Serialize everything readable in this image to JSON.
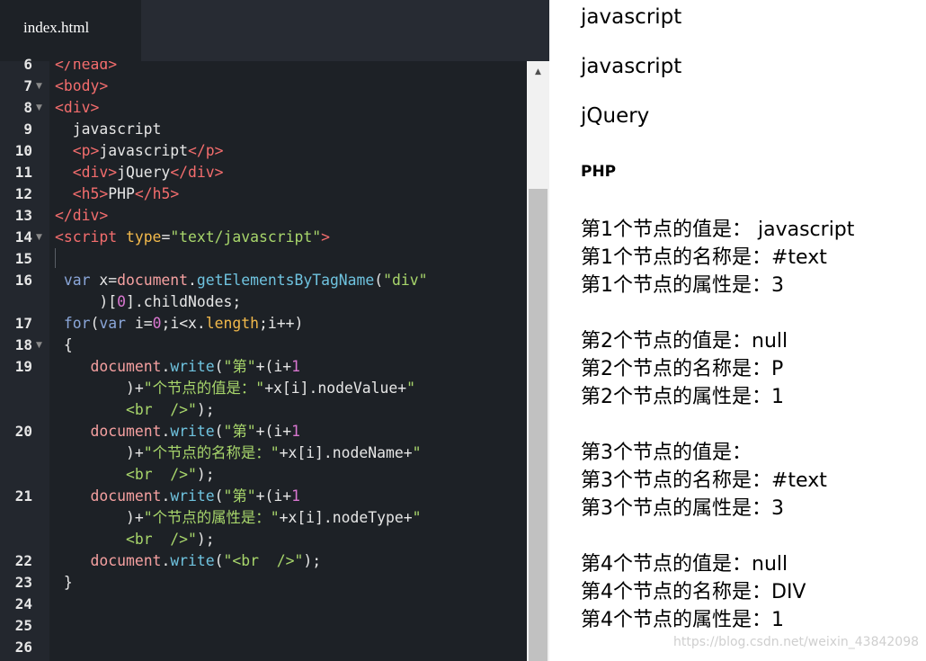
{
  "tab": {
    "title": "index.html"
  },
  "gutter": {
    "lines": [
      "6",
      "7",
      "8",
      "9",
      "10",
      "11",
      "12",
      "13",
      "14",
      "15",
      "16",
      "17",
      "18",
      "19",
      "20",
      "21",
      "22",
      "23",
      "24",
      "25",
      "26"
    ]
  },
  "code": {
    "l6": {
      "tag": "</head>"
    },
    "l7": {
      "tag": "<body>"
    },
    "l8": {
      "tag": "<div>"
    },
    "l9": {
      "text": "  javascript"
    },
    "l10": {
      "i": "  ",
      "open": "<p>",
      "text": "javascript",
      "close": "</p>"
    },
    "l11": {
      "i": "  ",
      "open": "<div>",
      "text": "jQuery",
      "close": "</div>"
    },
    "l12": {
      "i": "  ",
      "open": "<h5>",
      "text": "PHP",
      "close": "</h5>"
    },
    "l13": {
      "tag": "</div>"
    },
    "l14": {
      "open": "<script ",
      "attr": "type",
      "eq": "=",
      "val": "\"text/javascript\"",
      "close": ">"
    },
    "l16a": {
      "i": " ",
      "kw": "var",
      "a": " x=",
      "obj": "document",
      "dot": ".",
      "fn": "getElementsByTagName",
      "p": "(",
      "s": "\"div\""
    },
    "l16b": {
      "i": "     ",
      "a": ")[",
      "n": "0",
      "b": "].childNodes;"
    },
    "l17": {
      "i": " ",
      "kw": "for",
      "a": "(",
      "kw2": "var",
      "b": " i=",
      "n": "0",
      "c": ";i<x.",
      "prop": "length",
      "d": ";i++)"
    },
    "l18": {
      "text": " {"
    },
    "l19a": {
      "i": "    ",
      "obj": "document",
      "dot": ".",
      "fn": "write",
      "p": "(",
      "s": "\"第\"",
      "a": "+(i+",
      "n": "1"
    },
    "l19b": {
      "i": "        ",
      "a": ")+",
      "s": "\"个节点的值是：\"",
      "b": "+x[i].nodeValue+",
      "s2": "\""
    },
    "l19c": {
      "i": "        ",
      "s": "<br  />\"",
      "a": ");"
    },
    "l20a": {
      "i": "    ",
      "obj": "document",
      "dot": ".",
      "fn": "write",
      "p": "(",
      "s": "\"第\"",
      "a": "+(i+",
      "n": "1"
    },
    "l20b": {
      "i": "        ",
      "a": ")+",
      "s": "\"个节点的名称是：\"",
      "b": "+x[i].nodeName+",
      "s2": "\""
    },
    "l20c": {
      "i": "        ",
      "s": "<br  />\"",
      "a": ");"
    },
    "l21a": {
      "i": "    ",
      "obj": "document",
      "dot": ".",
      "fn": "write",
      "p": "(",
      "s": "\"第\"",
      "a": "+(i+",
      "n": "1"
    },
    "l21b": {
      "i": "        ",
      "a": ")+",
      "s": "\"个节点的属性是：\"",
      "b": "+x[i].nodeType+",
      "s2": "\""
    },
    "l21c": {
      "i": "        ",
      "s": "<br  />\"",
      "a": ");"
    },
    "l22": {
      "i": "    ",
      "obj": "document",
      "dot": ".",
      "fn": "write",
      "p": "(",
      "s": "\"<br  />\"",
      "a": ");"
    },
    "l23": {
      "text": " }"
    }
  },
  "preview": {
    "t1": "javascript",
    "t2": "javascript",
    "t3": "jQuery",
    "h5": "PHP",
    "n1": [
      "第1个节点的值是： javascript",
      "第1个节点的名称是：#text",
      "第1个节点的属性是：3"
    ],
    "n2": [
      "第2个节点的值是：null",
      "第2个节点的名称是：P",
      "第2个节点的属性是：1"
    ],
    "n3": [
      "第3个节点的值是：",
      "第3个节点的名称是：#text",
      "第3个节点的属性是：3"
    ],
    "n4": [
      "第4个节点的值是：null",
      "第4个节点的名称是：DIV",
      "第4个节点的属性是：1"
    ]
  },
  "watermark": "https://blog.csdn.net/weixin_43842098"
}
